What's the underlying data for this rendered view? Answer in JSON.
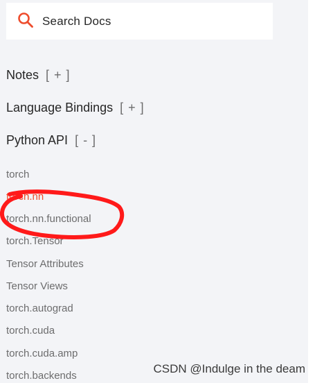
{
  "search": {
    "placeholder": "Search Docs"
  },
  "sections": {
    "notes": {
      "label": "Notes",
      "toggle": "[ + ]"
    },
    "language_bindings": {
      "label": "Language Bindings",
      "toggle": "[ + ]"
    },
    "python_api": {
      "label": "Python API",
      "toggle": "[ - ]"
    }
  },
  "nav_items": [
    "torch",
    "torch.nn",
    "torch.nn.functional",
    "torch.Tensor",
    "Tensor Attributes",
    "Tensor Views",
    "torch.autograd",
    "torch.cuda",
    "torch.cuda.amp",
    "torch.backends"
  ],
  "active_item": "torch.nn",
  "watermark": "CSDN @Indulge in the deam",
  "colors": {
    "accent": "#ee4c2c",
    "annotation": "#ff1a1a",
    "sidebar_bg": "#f3f4f7"
  }
}
